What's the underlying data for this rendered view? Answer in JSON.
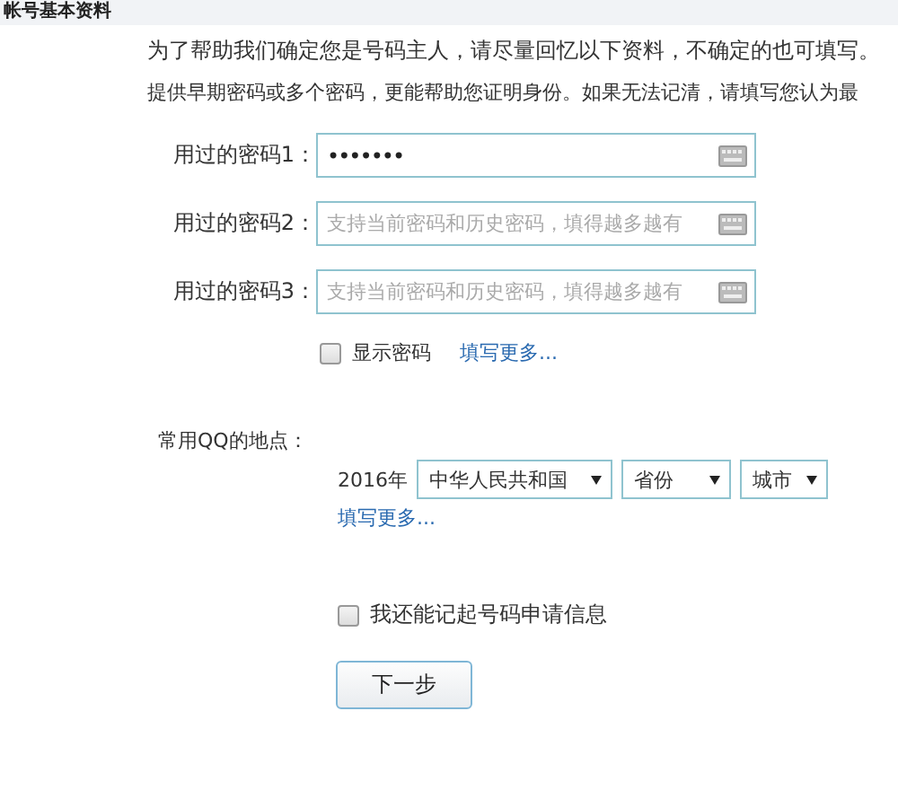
{
  "section": {
    "title": "帐号基本资料"
  },
  "intro": [
    "为了帮助我们确定您是号码主人，请尽量回忆以下资料，不确定的也可填写。",
    "提供早期密码或多个密码，更能帮助您证明身份。如果无法记清，请填写您认为最"
  ],
  "passwords": [
    {
      "label": "用过的密码1：",
      "value": "•••••••"
    },
    {
      "label": "用过的密码2：",
      "placeholder": "支持当前密码和历史密码，填得越多越有"
    },
    {
      "label": "用过的密码3：",
      "placeholder": "支持当前密码和历史密码，填得越多越有"
    }
  ],
  "show_password": {
    "label": "显示密码",
    "checked": false
  },
  "more_passwords_link": "填写更多...",
  "location": {
    "label": "常用QQ的地点：",
    "year": "2016年",
    "selects": [
      {
        "value": "中华人民共和国"
      },
      {
        "value": "省份"
      },
      {
        "value": "城市"
      }
    ],
    "more_link": "填写更多..."
  },
  "remember_info": {
    "label": "我还能记起号码申请信息",
    "checked": false
  },
  "next_button": "下一步"
}
